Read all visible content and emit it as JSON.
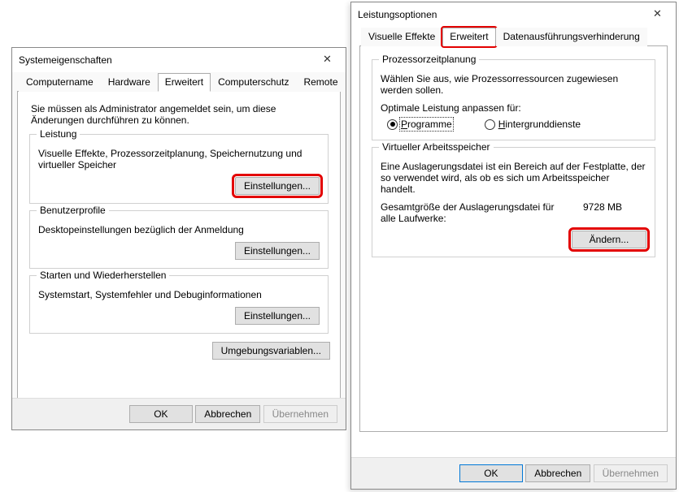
{
  "winA": {
    "title": "Systemeigenschaften",
    "tabs": [
      "Computername",
      "Hardware",
      "Erweitert",
      "Computerschutz",
      "Remote"
    ],
    "activeTab": 2,
    "adminNote": "Sie müssen als Administrator angemeldet sein, um diese Änderungen durchführen zu können.",
    "group1": {
      "title": "Leistung",
      "desc": "Visuelle Effekte, Prozessorzeitplanung, Speichernutzung und virtueller Speicher",
      "button": "Einstellungen..."
    },
    "group2": {
      "title": "Benutzerprofile",
      "desc": "Desktopeinstellungen bezüglich der Anmeldung",
      "button": "Einstellungen..."
    },
    "group3": {
      "title": "Starten und Wiederherstellen",
      "desc": "Systemstart, Systemfehler und Debuginformationen",
      "button": "Einstellungen..."
    },
    "envButton": "Umgebungsvariablen...",
    "footer": {
      "ok": "OK",
      "cancel": "Abbrechen",
      "apply": "Übernehmen"
    }
  },
  "winB": {
    "title": "Leistungsoptionen",
    "tabs": [
      "Visuelle Effekte",
      "Erweitert",
      "Datenausführungsverhinderung"
    ],
    "activeTab": 1,
    "group1": {
      "title": "Prozessorzeitplanung",
      "desc": "Wählen Sie aus, wie Prozessorressourcen zugewiesen werden sollen.",
      "optLabel": "Optimale Leistung anpassen für:",
      "radio1": "Programme",
      "radio2": "Hintergrunddienste"
    },
    "group2": {
      "title": "Virtueller Arbeitsspeicher",
      "desc": "Eine Auslagerungsdatei ist ein Bereich auf der Festplatte, der so verwendet wird, als ob es sich um Arbeitsspeicher handelt.",
      "sizeLabel": "Gesamtgröße der Auslagerungsdatei für alle Laufwerke:",
      "sizeValue": "9728 MB",
      "button": "Ändern..."
    },
    "footer": {
      "ok": "OK",
      "cancel": "Abbrechen",
      "apply": "Übernehmen"
    }
  }
}
